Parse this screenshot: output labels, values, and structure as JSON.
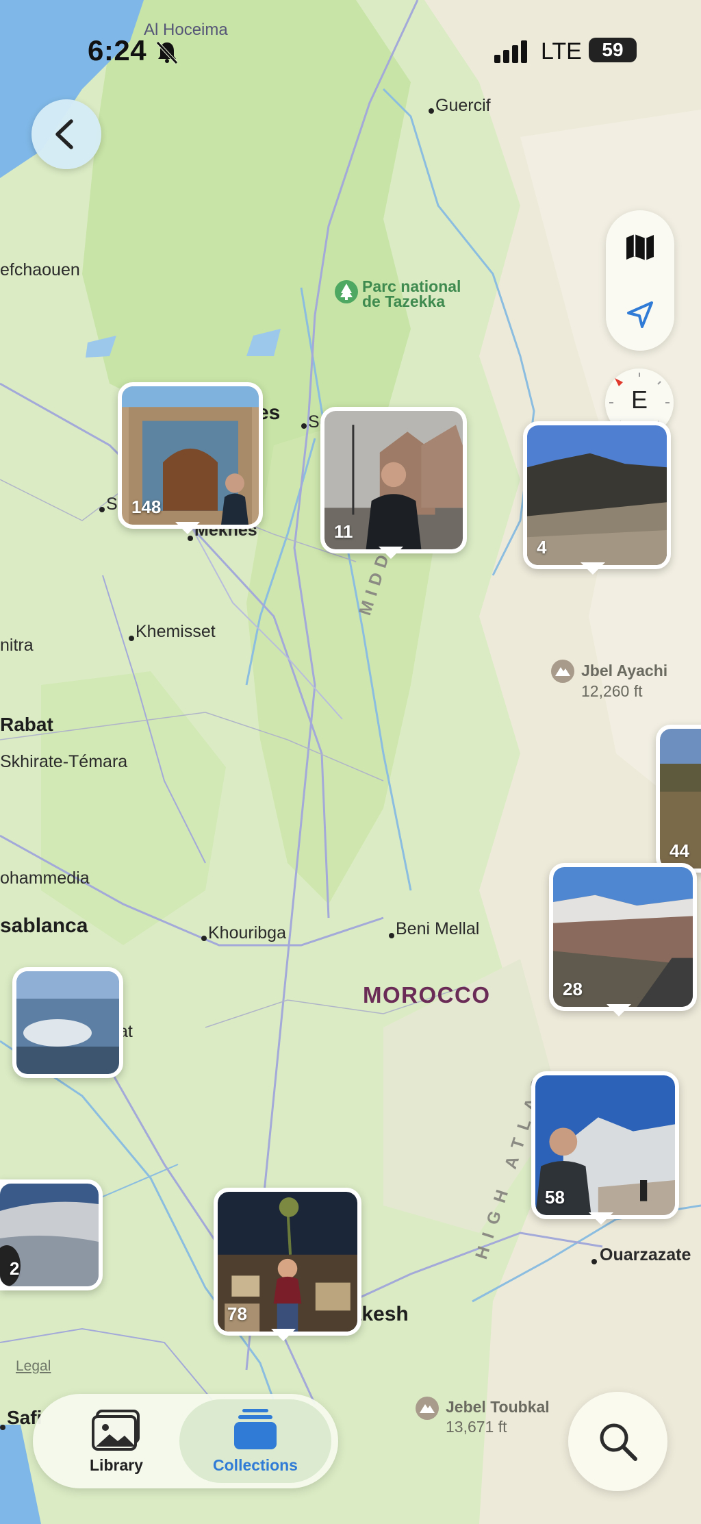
{
  "status_bar": {
    "time": "6:24",
    "network": "LTE",
    "battery": "59"
  },
  "map": {
    "country": "MOROCCO",
    "places": [
      {
        "name": "Al Hoceima"
      },
      {
        "name": "Guercif"
      },
      {
        "name": "efchaouen"
      },
      {
        "name": "es"
      },
      {
        "name": "Se"
      },
      {
        "name": "S"
      },
      {
        "name": "Meknes"
      },
      {
        "name": "Khemisset"
      },
      {
        "name": "nitra"
      },
      {
        "name": "Rabat"
      },
      {
        "name": "Skhirate-Témara"
      },
      {
        "name": "ohammedia"
      },
      {
        "name": "sablanca"
      },
      {
        "name": "Khouribga"
      },
      {
        "name": "Beni Mellal"
      },
      {
        "name": "tat"
      },
      {
        "name": "rakesh"
      },
      {
        "name": "Safi"
      },
      {
        "name": "Ouarzazate"
      }
    ],
    "park": {
      "line1": "Parc national",
      "line2": "de Tazekka"
    },
    "peaks": [
      {
        "name": "Jbel Ayachi",
        "elevation": "12,260 ft"
      },
      {
        "name": "Jebel Toubkal",
        "elevation": "13,671 ft"
      }
    ],
    "ranges": {
      "middle_atlas": "M I D D L E   A T L A S",
      "high_atlas": "H I G H   A T L A S"
    },
    "legal": "Legal",
    "compass": "E"
  },
  "clusters": [
    {
      "count": "148",
      "photo": "meknes-gate"
    },
    {
      "count": "11",
      "photo": "ifrane-street"
    },
    {
      "count": "4",
      "photo": "mountain-desert"
    },
    {
      "count": "44",
      "photo": "canyon-view"
    },
    {
      "count": "28",
      "photo": "snow-hills-road"
    },
    {
      "count": "58",
      "photo": "man-snowy-mountains"
    },
    {
      "count": "",
      "photo": "airplane-clouds"
    },
    {
      "count": "2",
      "photo": "airplane-clouds-2"
    },
    {
      "count": "78",
      "photo": "marrakesh-night"
    }
  ],
  "tabs": {
    "library": "Library",
    "collections": "Collections"
  },
  "colors": {
    "accent": "#2f7bd6",
    "country_label": "#6a2b57"
  }
}
